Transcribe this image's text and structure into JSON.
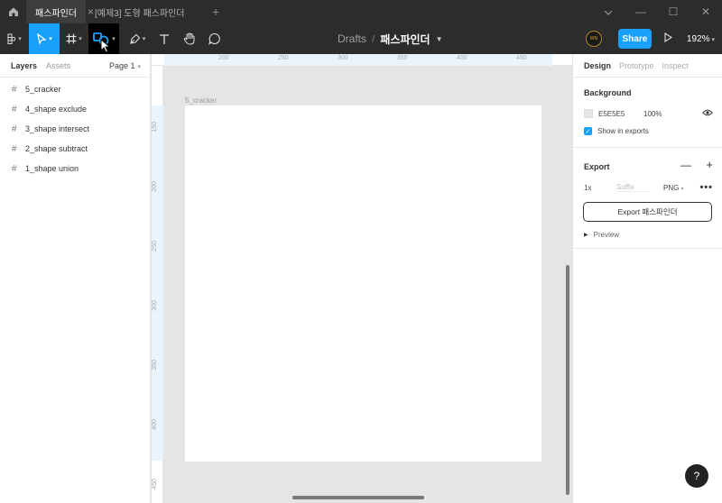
{
  "titlebar": {
    "tabs": [
      {
        "label": "패스파인더",
        "close": "×"
      },
      {
        "label": "[예제3] 도형 패스파인더"
      }
    ],
    "add_tab": "+",
    "window_controls": {
      "minimize": "—",
      "restore": "☐",
      "close": "✕"
    },
    "icons": [
      "home-icon",
      "chevron-down-icon"
    ]
  },
  "toolbar": {
    "tools": [
      "main-menu",
      "move",
      "frame",
      "shape",
      "pen",
      "text",
      "hand",
      "comment"
    ],
    "active_tool": "move",
    "accent_color": "#18a0fb",
    "breadcrumb": {
      "folder": "Drafts",
      "separator": "/",
      "file": "패스파인더"
    },
    "avatar_text": "WN",
    "share_label": "Share",
    "zoom_label": "192%"
  },
  "left_panel": {
    "tabs": {
      "layers": "Layers",
      "assets": "Assets"
    },
    "page_label": "Page 1",
    "layers": [
      {
        "label": "5_cracker"
      },
      {
        "label": "4_shape exclude"
      },
      {
        "label": "3_shape intersect"
      },
      {
        "label": "2_shape subtract"
      },
      {
        "label": "1_shape union"
      }
    ]
  },
  "rulers": {
    "top": [
      "200",
      "250",
      "300",
      "350",
      "400",
      "450"
    ],
    "left": [
      "150",
      "200",
      "250",
      "300",
      "350",
      "400",
      "450"
    ]
  },
  "canvas": {
    "frame_label": "5_cracker",
    "background_color": "#e5e5e5"
  },
  "right_panel": {
    "tabs": {
      "design": "Design",
      "prototype": "Prototype",
      "inspect": "Inspect"
    },
    "background": {
      "title": "Background",
      "hex": "E5E5E5",
      "opacity": "100%",
      "show_in_exports": "Show in exports"
    },
    "export": {
      "title": "Export",
      "scale": "1x",
      "suffix_placeholder": "Suffix",
      "format": "PNG",
      "button_label": "Export 패스파인더",
      "preview_label": "Preview"
    }
  },
  "help_label": "?"
}
